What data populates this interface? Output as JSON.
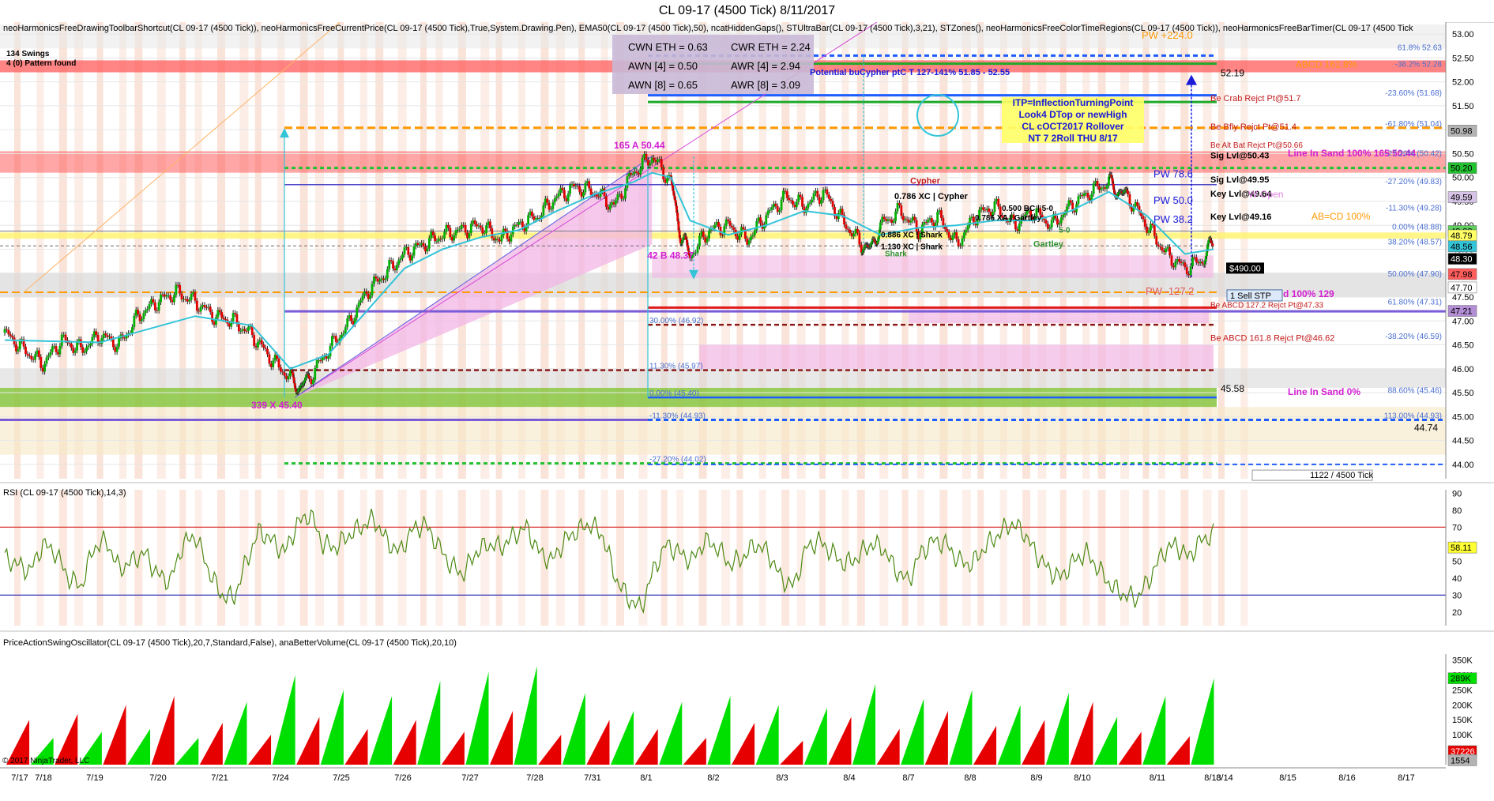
{
  "window": {
    "title": "CL 09-17 (4500 Tick)  8/11/2017"
  },
  "main_panel": {
    "indicators": "neoHarmonicsFreeDrawingToolbarShortcut(CL 09-17 (4500 Tick)), neoHarmonicsFreeCurrentPrice(CL 09-17 (4500 Tick),True,System.Drawing.Pen), EMA50(CL 09-17 (4500 Tick),50), ncatHiddenGaps(), STUltraBar(CL 09-17 (4500 Tick),3,21), STZones(), neoHarmonicsFreeColorTimeRegions(CL 09-17 (4500 Tick)), neoHarmonicsFreeBarTimer(CL 09-17 (4500 Tick",
    "swings_line1": "134 Swings",
    "swings_line2": "4 (0) Pattern found",
    "stats": [
      "CWN ETH = 0.63",
      "CWR ETH = 2.24",
      "AWN [4] = 0.50",
      "AWR [4] = 2.94",
      "AWN [8] = 0.65",
      "AWR [8] = 3.09"
    ],
    "annotations": {
      "potential": "Potential buCypher ptC T 127-141% 51.85 - 52.55",
      "itp": [
        "ITP=InflectionTurningPoint",
        "Look4 DTop or newHigh",
        "CL cOCT2017 Rollover",
        "NT 7 2Roll THU 8/17"
      ],
      "point_a": "165  A  50.44",
      "point_b": "42  B  48.37",
      "point_x": "339  X  45.40",
      "cypher": "Cypher",
      "pattern_786": "0.786 XC | Cypher",
      "pattern_500": "0.500 BC | 5-0",
      "pattern_786xa": "0.786 XA | Gartley",
      "pattern_886": "0.886 XC | Shark",
      "pattern_1130": "1.130 XC | Shark",
      "shark": "Shark",
      "gartley": "Gartley",
      "five_zero": "5-0",
      "pw_224": "PW +224.0",
      "pw_78": "PW 78.6",
      "pw_50": "PW 50.0",
      "pw_38": "PW 38.2",
      "pw_127": "PW -127.2",
      "abcd": "ABCD   161.8%",
      "crab": "Be Crab Rejct Pt@51.7",
      "bfly": "Be Bfly Rejct Pt@51.4",
      "altbat": "Be Alt Bat Rejct Pt@50.66",
      "line_in_sand_top": "Line In Sand   100%   165   50.44",
      "line_in_sand_mid": "Line In Sand   100%   129",
      "line_in_sand_bot": "Line In Sand   0%",
      "sig_5043": "Sig Lvl@50.43",
      "sig_4995": "Sig Lvl@49.95",
      "key_4964": "Key Lvl@49.64",
      "key_4916": "Key Lvl@49.16",
      "w_open": "W-Open",
      "abcd_cd": "AB=CD   100%",
      "be_abcd": "Be ABCD 161.8 Rejct Pt@46.62",
      "be_abcd127": "Be ABCD 127.2 Rejct Pt@47.33",
      "price_5219": "52.19",
      "price_4558": "45.58",
      "price_4474": "44.74",
      "pnl": "$490.00",
      "sell_stp": "1  Sell STP",
      "tick_counter": "1122 / 4500 Tick",
      "fib_labels": [
        "61.8%  52.63",
        "-38.2%  52.28",
        "-23.60%  (51.68)",
        "-61.80%  (51.04)",
        "-27.20%  (50.42)",
        "-27.20%  (49.83)",
        "-11.30%  (49.28)",
        "0.00%  (48.88)",
        "38.20%  (48.57)",
        "61.80%  (47.31)",
        "50.00%  (47.90)",
        "30.00%  (46.92)",
        "11.30%  (45.97)",
        "0.00%  (45.40)",
        "-11.30%  (44.93)",
        "-27.20%  (44.02)",
        "-38.20%  (46.59)",
        "88.60%  (45.46)",
        "113.00%  (44.93)"
      ]
    },
    "badges": [
      "50.98",
      "50.20",
      "49.59",
      "48.88",
      "48.79",
      "48.56",
      "48.30",
      "47.98",
      "47.70",
      "47.21"
    ]
  },
  "rsi_panel": {
    "label": "RSI (CL 09-17 (4500 Tick),14,3)",
    "current_badge": "58.11"
  },
  "osc_panel": {
    "label": "PriceActionSwingOscillator(CL 09-17 (4500 Tick),20,7,Standard,False), anaBetterVolume(CL 09-17 (4500 Tick),20,10)",
    "copyright": "© 2017 NinjaTrader, LLC",
    "badge_green": "289K",
    "badge_red": "37226",
    "badge_grey": "1554"
  },
  "colors": {
    "up_bar": "#00b000",
    "down_bar": "#e00000",
    "ema": "#33c4d8",
    "rsi_line": "#4d8a14",
    "pink_zone": "#f2b6e6",
    "red_band": "#ff5c5c",
    "green_band": "#88c640",
    "orange_dash": "#ff9900",
    "blue_line": "#1e5dff",
    "purple_line": "#7a5cd6"
  },
  "chart_data": [
    {
      "type": "candlestick",
      "title": "CL 09-17 (4500 Tick)  8/11/2017",
      "x_tick_labels": [
        "7/17",
        "7/18",
        "7/19",
        "7/20",
        "7/21",
        "7/24",
        "7/25",
        "7/26",
        "7/27",
        "7/28",
        "7/31",
        "8/1",
        "8/2",
        "8/3",
        "8/4",
        "8/7",
        "8/8",
        "8/9",
        "8/10",
        "8/11",
        "8/13",
        "8/14",
        "8/15",
        "8/16",
        "8/17"
      ],
      "y_ticks": [
        44.0,
        44.5,
        45.0,
        45.5,
        46.0,
        46.5,
        47.0,
        47.5,
        48.0,
        48.5,
        49.0,
        49.5,
        50.0,
        50.5,
        51.0,
        51.5,
        52.0,
        52.5,
        53.0
      ],
      "ylim": [
        43.7,
        53.25
      ],
      "price_path": [
        [
          0,
          46.75
        ],
        [
          20,
          46.4
        ],
        [
          40,
          46.1
        ],
        [
          60,
          46.6
        ],
        [
          80,
          46.4
        ],
        [
          100,
          46.7
        ],
        [
          120,
          46.5
        ],
        [
          140,
          47.1
        ],
        [
          160,
          47.4
        ],
        [
          180,
          47.6
        ],
        [
          200,
          47.4
        ],
        [
          220,
          47.1
        ],
        [
          240,
          47.0
        ],
        [
          260,
          46.7
        ],
        [
          280,
          46.2
        ],
        [
          300,
          45.8
        ],
        [
          310,
          45.6
        ],
        [
          320,
          45.8
        ],
        [
          340,
          46.4
        ],
        [
          360,
          46.9
        ],
        [
          380,
          47.6
        ],
        [
          400,
          48.0
        ],
        [
          420,
          48.4
        ],
        [
          440,
          48.6
        ],
        [
          460,
          48.8
        ],
        [
          480,
          48.9
        ],
        [
          500,
          49.0
        ],
        [
          520,
          48.7
        ],
        [
          540,
          49.0
        ],
        [
          560,
          49.2
        ],
        [
          580,
          49.6
        ],
        [
          600,
          49.8
        ],
        [
          620,
          49.7
        ],
        [
          640,
          49.4
        ],
        [
          660,
          50.1
        ],
        [
          680,
          50.44
        ],
        [
          700,
          49.9
        ],
        [
          710,
          48.8
        ],
        [
          720,
          48.37
        ],
        [
          740,
          48.9
        ],
        [
          760,
          49.0
        ],
        [
          780,
          48.7
        ],
        [
          800,
          49.2
        ],
        [
          820,
          49.6
        ],
        [
          840,
          49.4
        ],
        [
          860,
          49.7
        ],
        [
          880,
          49.1
        ],
        [
          900,
          48.6
        ],
        [
          910,
          48.5
        ],
        [
          920,
          49.0
        ],
        [
          940,
          49.3
        ],
        [
          960,
          48.9
        ],
        [
          980,
          49.2
        ],
        [
          1000,
          48.6
        ],
        [
          1020,
          49.2
        ],
        [
          1040,
          49.4
        ],
        [
          1060,
          49.0
        ],
        [
          1080,
          49.3
        ],
        [
          1100,
          49.0
        ],
        [
          1120,
          49.4
        ],
        [
          1140,
          49.7
        ],
        [
          1160,
          49.9
        ],
        [
          1170,
          49.7
        ],
        [
          1180,
          49.6
        ],
        [
          1200,
          49.0
        ],
        [
          1220,
          48.4
        ],
        [
          1240,
          48.1
        ],
        [
          1260,
          48.3
        ],
        [
          1270,
          48.7
        ]
      ],
      "ema_path": [
        [
          0,
          46.6
        ],
        [
          100,
          46.55
        ],
        [
          200,
          47.1
        ],
        [
          260,
          46.9
        ],
        [
          300,
          46.0
        ],
        [
          340,
          46.3
        ],
        [
          380,
          47.2
        ],
        [
          420,
          48.1
        ],
        [
          460,
          48.5
        ],
        [
          500,
          48.75
        ],
        [
          540,
          48.9
        ],
        [
          580,
          49.3
        ],
        [
          620,
          49.65
        ],
        [
          660,
          49.9
        ],
        [
          680,
          50.1
        ],
        [
          700,
          50.0
        ],
        [
          720,
          49.1
        ],
        [
          760,
          48.8
        ],
        [
          800,
          49.0
        ],
        [
          840,
          49.3
        ],
        [
          880,
          49.2
        ],
        [
          920,
          48.8
        ],
        [
          960,
          48.95
        ],
        [
          1000,
          49.0
        ],
        [
          1040,
          49.1
        ],
        [
          1080,
          49.1
        ],
        [
          1120,
          49.3
        ],
        [
          1160,
          49.7
        ],
        [
          1200,
          49.2
        ],
        [
          1240,
          48.4
        ],
        [
          1270,
          48.5
        ]
      ]
    },
    {
      "type": "line",
      "name": "RSI",
      "ylim": [
        12,
        92
      ],
      "y_ticks": [
        20,
        30,
        40,
        50,
        60,
        70,
        80,
        90
      ],
      "levels": [
        30,
        70
      ],
      "values": [
        52,
        48,
        44,
        60,
        55,
        40,
        35,
        58,
        62,
        45,
        50,
        55,
        42,
        38,
        60,
        65,
        45,
        30,
        28,
        50,
        68,
        62,
        55,
        72,
        78,
        60,
        58,
        65,
        70,
        75,
        62,
        55,
        68,
        72,
        60,
        48,
        42,
        55,
        60,
        58,
        65,
        70,
        55,
        50,
        62,
        68,
        72,
        65,
        40,
        28,
        22,
        45,
        60,
        55,
        50,
        62,
        58,
        48,
        52,
        60,
        55,
        40,
        35,
        58,
        62,
        55,
        48,
        52,
        60,
        58,
        45,
        38,
        55,
        62,
        60,
        50,
        48,
        58,
        65,
        72,
        68,
        55,
        45,
        40,
        50,
        55,
        45,
        35,
        30,
        28,
        40,
        55,
        60,
        52,
        62,
        66
      ]
    },
    {
      "type": "bar",
      "name": "PriceActionSwingOscillator",
      "ylim": [
        0,
        370000
      ],
      "y_ticks": [
        50000,
        100000,
        150000,
        200000,
        250000,
        300000,
        350000
      ],
      "y_tick_labels": [
        "50K",
        "100K",
        "150K",
        "200K",
        "250K",
        "300K",
        "350K"
      ],
      "swings": [
        {
          "color": "red",
          "height": 150000
        },
        {
          "color": "green",
          "height": 90000
        },
        {
          "color": "red",
          "height": 170000
        },
        {
          "color": "green",
          "height": 110000
        },
        {
          "color": "red",
          "height": 200000
        },
        {
          "color": "green",
          "height": 120000
        },
        {
          "color": "red",
          "height": 230000
        },
        {
          "color": "green",
          "height": 90000
        },
        {
          "color": "red",
          "height": 140000
        },
        {
          "color": "green",
          "height": 210000
        },
        {
          "color": "red",
          "height": 100000
        },
        {
          "color": "green",
          "height": 300000
        },
        {
          "color": "red",
          "height": 160000
        },
        {
          "color": "green",
          "height": 250000
        },
        {
          "color": "red",
          "height": 120000
        },
        {
          "color": "green",
          "height": 230000
        },
        {
          "color": "red",
          "height": 150000
        },
        {
          "color": "green",
          "height": 280000
        },
        {
          "color": "red",
          "height": 110000
        },
        {
          "color": "green",
          "height": 310000
        },
        {
          "color": "red",
          "height": 180000
        },
        {
          "color": "green",
          "height": 330000
        },
        {
          "color": "red",
          "height": 100000
        },
        {
          "color": "green",
          "height": 240000
        },
        {
          "color": "red",
          "height": 150000
        },
        {
          "color": "green",
          "height": 180000
        },
        {
          "color": "red",
          "height": 120000
        },
        {
          "color": "green",
          "height": 210000
        },
        {
          "color": "red",
          "height": 90000
        },
        {
          "color": "green",
          "height": 230000
        },
        {
          "color": "red",
          "height": 140000
        },
        {
          "color": "green",
          "height": 200000
        },
        {
          "color": "red",
          "height": 80000
        },
        {
          "color": "green",
          "height": 190000
        },
        {
          "color": "red",
          "height": 160000
        },
        {
          "color": "green",
          "height": 270000
        },
        {
          "color": "red",
          "height": 120000
        },
        {
          "color": "green",
          "height": 220000
        },
        {
          "color": "red",
          "height": 180000
        },
        {
          "color": "green",
          "height": 250000
        },
        {
          "color": "red",
          "height": 130000
        },
        {
          "color": "green",
          "height": 200000
        },
        {
          "color": "red",
          "height": 150000
        },
        {
          "color": "green",
          "height": 240000
        },
        {
          "color": "red",
          "height": 210000
        },
        {
          "color": "green",
          "height": 160000
        },
        {
          "color": "red",
          "height": 110000
        },
        {
          "color": "green",
          "height": 230000
        },
        {
          "color": "red",
          "height": 95000
        },
        {
          "color": "green",
          "height": 289000
        }
      ]
    }
  ]
}
